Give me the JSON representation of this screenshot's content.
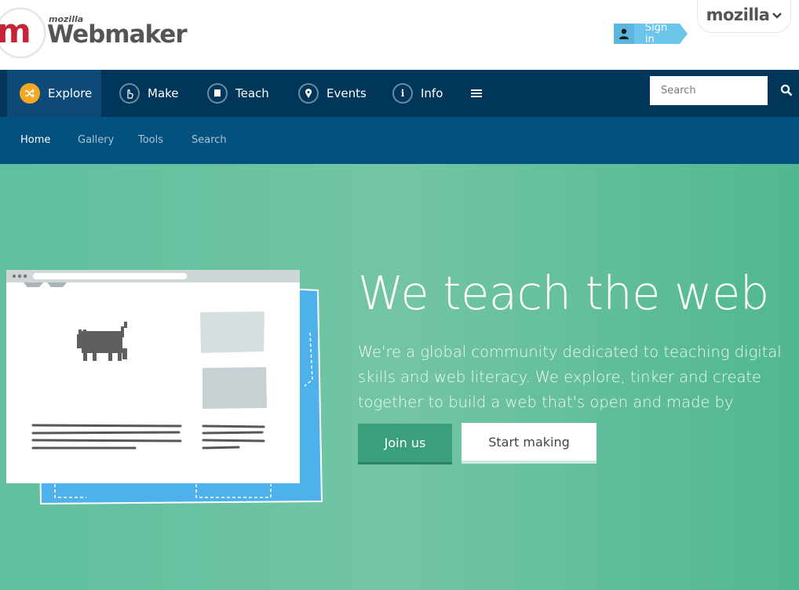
{
  "header": {
    "logo_small": "mozilla",
    "logo_big": "Webmaker",
    "logo_letter": "m",
    "sign_in": "Sign in",
    "mozilla_tab": "mozilla"
  },
  "nav": {
    "items": [
      {
        "label": "Explore",
        "icon": "shuffle-icon"
      },
      {
        "label": "Make",
        "icon": "hand-pointer-icon"
      },
      {
        "label": "Teach",
        "icon": "book-icon"
      },
      {
        "label": "Events",
        "icon": "map-pin-icon"
      },
      {
        "label": "Info",
        "icon": "info-icon"
      }
    ],
    "menu_icon": "hamburger-menu-icon",
    "search_placeholder": "Search",
    "search_icon": "search-icon"
  },
  "subnav": {
    "items": [
      "Home",
      "Gallery",
      "Tools",
      "Search"
    ],
    "current": "Home"
  },
  "hero": {
    "title": "We teach the web",
    "text": "We're a global community dedicated to teaching digital skills and web literacy. We explore, tinker and create together to build a web that's open and made by everyone.",
    "join_button": "Join us",
    "start_button": "Start making"
  },
  "colors": {
    "nav_bg": "#003659",
    "subnav_bg": "#04507f",
    "hero_bg": "#5fbf9e",
    "accent_orange": "#f5a623",
    "brand_red": "#c7243a",
    "signin_blue": "#6cc5eb"
  }
}
